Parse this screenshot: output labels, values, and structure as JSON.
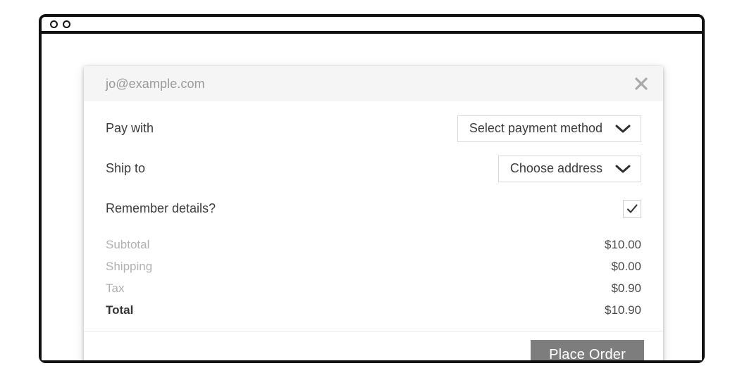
{
  "browser": {
    "dots": [
      "window-dot-1",
      "window-dot-2"
    ]
  },
  "dialog": {
    "email": "jo@example.com",
    "close_icon": "close-icon",
    "rows": [
      {
        "label": "Pay with",
        "control": "select",
        "value": "Select payment method",
        "icon": "chevron-down-icon"
      },
      {
        "label": "Ship to",
        "control": "select",
        "value": "Choose address",
        "icon": "chevron-down-icon"
      },
      {
        "label": "Remember details?",
        "control": "checkbox",
        "checked": true,
        "icon": "check-icon"
      }
    ],
    "totals": [
      {
        "label": "Subtotal",
        "value": "$10.00",
        "emphasis": false
      },
      {
        "label": "Shipping",
        "value": "$0.00",
        "emphasis": false
      },
      {
        "label": "Tax",
        "value": "$0.90",
        "emphasis": false
      },
      {
        "label": "Total",
        "value": "$10.90",
        "emphasis": true
      }
    ],
    "footer": {
      "place_order_label": "Place Order"
    }
  },
  "colors": {
    "frame": "#111111",
    "header_bg": "#f5f5f5",
    "email_text": "#9a9a9a",
    "label_text": "#3c3c3c",
    "muted_text": "#b0b0b0",
    "value_text": "#4a4a4a",
    "button_bg": "#7d7d7d",
    "button_text": "#ffffff",
    "border": "#d8d8d8"
  }
}
